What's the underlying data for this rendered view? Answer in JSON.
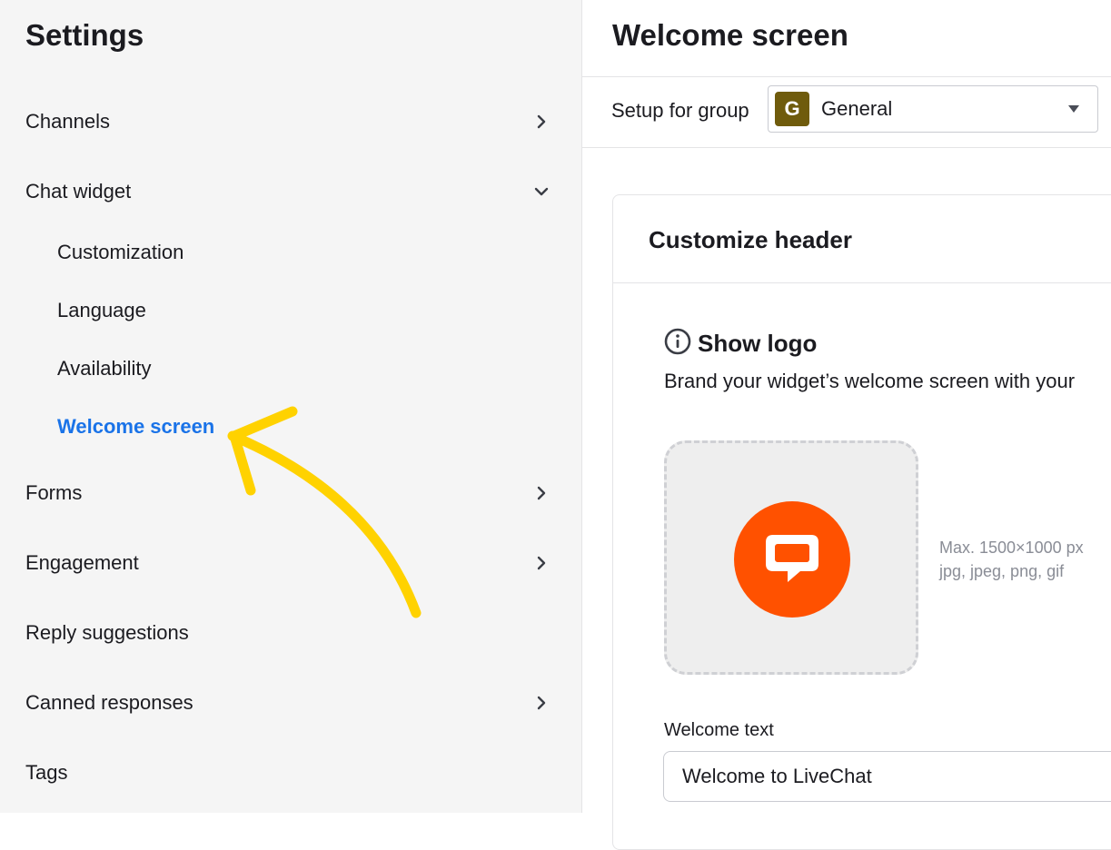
{
  "sidebar": {
    "title": "Settings",
    "items": [
      {
        "label": "Channels"
      },
      {
        "label": "Chat widget"
      },
      {
        "label": "Customization"
      },
      {
        "label": "Language"
      },
      {
        "label": "Availability"
      },
      {
        "label": "Welcome screen"
      },
      {
        "label": "Forms"
      },
      {
        "label": "Engagement"
      },
      {
        "label": "Reply suggestions"
      },
      {
        "label": "Canned responses"
      },
      {
        "label": "Tags"
      }
    ]
  },
  "header": {
    "title": "Welcome screen"
  },
  "group": {
    "label": "Setup for group",
    "avatar_letter": "G",
    "selected": "General"
  },
  "card": {
    "title": "Customize header",
    "section_title": "Show logo",
    "section_desc": "Brand your widget’s welcome screen with your",
    "hint_size": "Max. 1500×1000 px",
    "hint_types": "jpg, jpeg, png, gif",
    "welcome_label": "Welcome text",
    "welcome_value": "Welcome to LiveChat"
  },
  "colors": {
    "accent": "#1a73e8",
    "logo": "#ff5100",
    "group_avatar": "#6f5b0c",
    "annotation_arrow": "#ffd200"
  },
  "icons": [
    "chevron-right-icon",
    "chevron-down-icon",
    "info-icon",
    "livechat-logo-icon",
    "caret-down-icon"
  ]
}
